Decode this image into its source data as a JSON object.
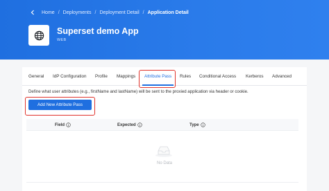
{
  "breadcrumb": {
    "items": [
      "Home",
      "Deployments",
      "Deployment Detail"
    ],
    "current": "Application Detail",
    "separator": "/"
  },
  "app": {
    "name": "Superset demo App",
    "type": "WEB",
    "icon": "globe-icon"
  },
  "tabs": [
    {
      "label": "General",
      "active": false
    },
    {
      "label": "IdP Configuration",
      "active": false
    },
    {
      "label": "Profile",
      "active": false
    },
    {
      "label": "Mappings",
      "active": false
    },
    {
      "label": "Attribute Pass",
      "active": true
    },
    {
      "label": "Rules",
      "active": false
    },
    {
      "label": "Conditional Access",
      "active": false
    },
    {
      "label": "Kerberos",
      "active": false
    },
    {
      "label": "Advanced",
      "active": false
    }
  ],
  "attribute_pass": {
    "description": "Define what user attributes (e.g., firstName and lastName) will be sent to the proxied application via header or cookie.",
    "add_button": "Add New Attribute Pass",
    "columns": [
      "Field",
      "Expected",
      "Type"
    ],
    "empty_text": "No Data"
  },
  "colors": {
    "header": "#1f6fe0",
    "primary": "#1f6fe0",
    "highlight": "#e0322b"
  }
}
